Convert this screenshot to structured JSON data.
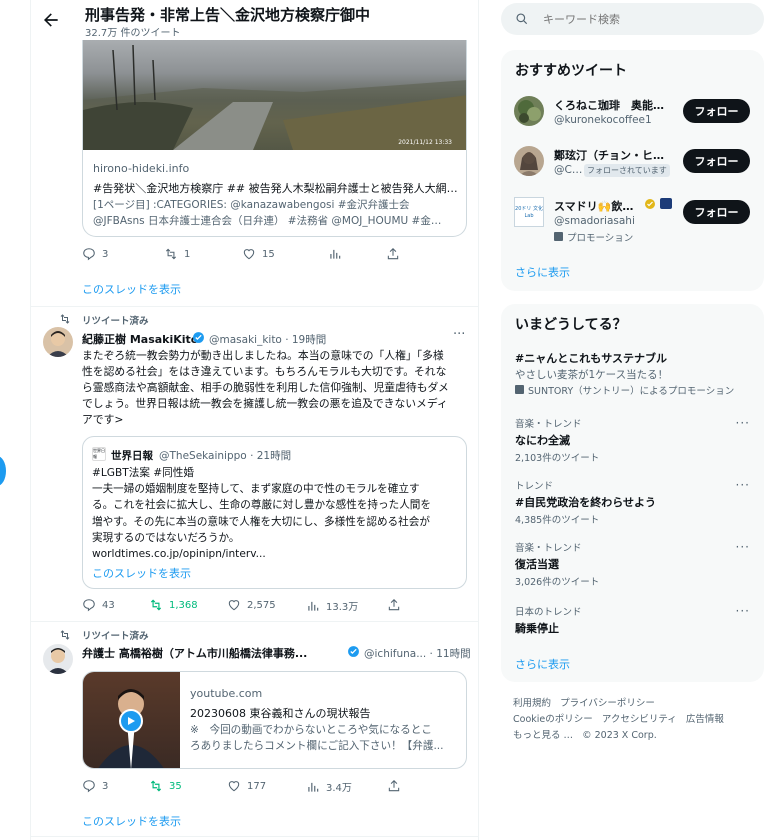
{
  "header": {
    "title": "刑事告発・非常上告＼金沢地方検察庁御中",
    "subtitle": "32.7万 件のツイート"
  },
  "tweet1": {
    "image_timestamp": "2021/11/12 13:33",
    "card_domain": "hirono-hideki.info",
    "card_title": "#告発状＼金沢地方検察庁 ## 被告発人木梨松嗣弁護士と被告発人大網…",
    "card_desc1": "[1ページ目] :CATEGORIES: @kanazawabengosi #金沢弁護士会",
    "card_desc2": "@JFBAsns 日本弁護士連合会（日弁連） #法務省 @MOJ_HOUMU #金…",
    "replies": "3",
    "retweets": "1",
    "likes": "15",
    "show_thread": "このスレッドを表示"
  },
  "tweet2": {
    "retweet_label": "リツイート済み",
    "name": "紀藤正樹 MasakiKito",
    "handle_time": "@masaki_kito · 19時間",
    "text_lines": [
      "またぞろ統一教会勢力が動き出しましたね。本当の意味での「人権」「多様",
      "性を認める社会」をはき違えています。もちろんモラルも大切です。それな",
      "ら霊感商法や高額献金、相手の脆弱性を利用した信仰強制、児童虐待もダメ",
      "でしょう。世界日報は統一教会を擁護し統一教会の悪を追及できないメディ",
      "アです>"
    ],
    "quote_avatar_text": "世界日報",
    "quote_name": "世界日報",
    "quote_handle_time": "@TheSekainippo · 21時間",
    "quote_lines": [
      "#LGBT法案 #同性婚",
      "一夫一婦の婚姻制度を堅持して、まず家庭の中で性のモラルを確立す",
      "る。これを社会に拡大し、生命の尊厳に対し豊かな感性を持った人間を",
      "増やす。その先に本当の意味で人権を大切にし、多様性を認める社会が",
      "実現するのではないだろうか。",
      "worldtimes.co.jp/opinipn/interv..."
    ],
    "quote_show_thread": "このスレッドを表示",
    "replies": "43",
    "retweets": "1,368",
    "likes": "2,575",
    "views": "13.3万"
  },
  "tweet3": {
    "retweet_label": "リツイート済み",
    "name": "弁護士 高橋裕樹（アトム市川船橋法律事務...",
    "handle_time": "@ichifuna... · 11時間",
    "card_domain": "youtube.com",
    "card_title": "20230608 東谷義和さんの現状報告",
    "card_desc1": "※　今回の動画でわからないところや気になるとこ",
    "card_desc2": "ろありましたらコメント欄にご記入下さい！【弁護...",
    "replies": "3",
    "retweets": "35",
    "likes": "177",
    "views": "3.4万",
    "show_thread": "このスレッドを表示"
  },
  "search": {
    "placeholder": "キーワード検索"
  },
  "recommend": {
    "title": "おすすめツイート",
    "users": [
      {
        "name": "くろねこ珈琲　奥能…",
        "handle": "@kuronekocoffee1",
        "button": "フォロー"
      },
      {
        "name": "鄭玹汀（チョン・ヒ…",
        "handle": "@C…",
        "badge": "フォローされています",
        "button": "フォロー"
      },
      {
        "name": "スマドリ🙌飲…",
        "handle": "@smadoriasahi",
        "promo": "プロモーション",
        "button": "フォロー",
        "avatar_text": "20ドリ 文化 Lab"
      }
    ],
    "more": "さらに表示"
  },
  "trends": {
    "title": "いまどうしてる？",
    "promoted": {
      "title": "#ニャんとこれもサステナブル",
      "desc": "やさしい麦茶が1ケース当たる！",
      "by": "SUNTORY（サントリー）によるプロモーション"
    },
    "items": [
      {
        "context": "音楽・トレンド",
        "name": "なにわ全滅",
        "count": "2,103件のツイート"
      },
      {
        "context": "トレンド",
        "name": "#自民党政治を終わらせよう",
        "count": "4,385件のツイート"
      },
      {
        "context": "音楽・トレンド",
        "name": "復活当選",
        "count": "3,026件のツイート"
      },
      {
        "context": "日本のトレンド",
        "name": "騎乗停止",
        "count": ""
      }
    ],
    "more": "さらに表示"
  },
  "footer": {
    "links": [
      "利用規約",
      "プライバシーポリシー",
      "Cookieのポリシー",
      "アクセシビリティ",
      "広告情報",
      "もっと見る …",
      "© 2023 X Corp."
    ]
  },
  "colors": {
    "accent": "#1d9bf0",
    "retweet_green": "#00ba7c",
    "text": "#0f1419",
    "secondary": "#536471"
  }
}
